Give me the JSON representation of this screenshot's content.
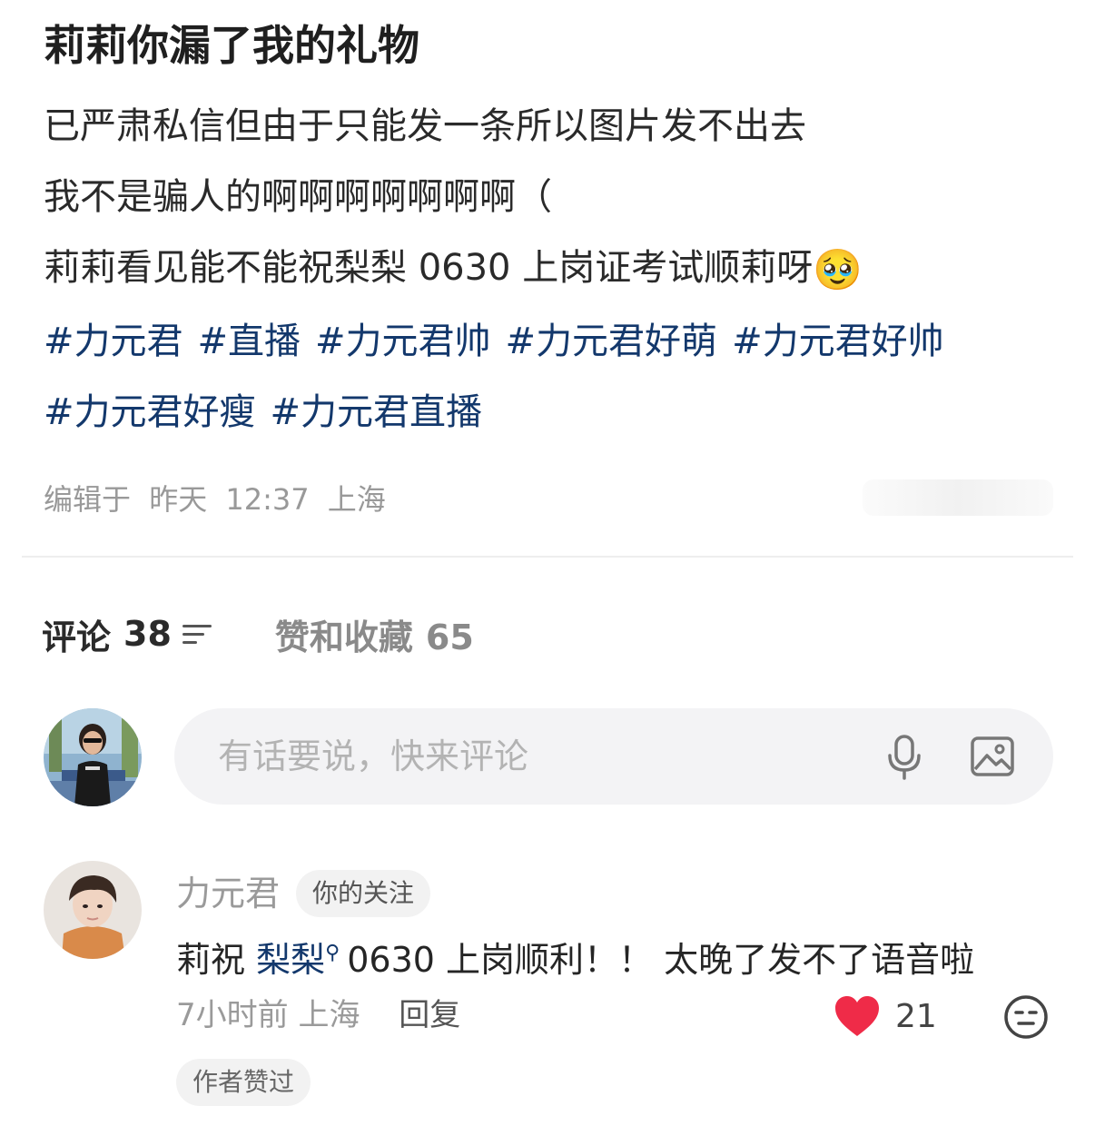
{
  "post": {
    "title": "莉莉你漏了我的礼物",
    "lines": [
      "已严肃私信但由于只能发一条所以图片发不出去",
      "我不是骗人的啊啊啊啊啊啊啊（",
      "莉莉看见能不能祝梨梨 0630 上岗证考试顺莉呀"
    ],
    "emoji": "🥹",
    "hashtags": [
      "#力元君",
      "#直播",
      "#力元君帅",
      "#力元君好萌",
      "#力元君好帅",
      "#力元君好瘦",
      "#力元君直播"
    ]
  },
  "meta": {
    "edited": "编辑于",
    "day": "昨天",
    "time": "12:37",
    "location": "上海"
  },
  "tabs": {
    "comments_label": "评论",
    "comments_count": "38",
    "likes_label": "赞和收藏",
    "likes_count": "65"
  },
  "composer": {
    "placeholder": "有话要说，快来评论",
    "mic_icon": "microphone-icon",
    "image_icon": "image-icon"
  },
  "comment": {
    "author": "力元君",
    "badge": "你的关注",
    "text_before": "莉祝",
    "mention": "梨梨",
    "text_after": "0630 上岗顺利！！ 太晚了发不了语音啦",
    "time": "7小时前",
    "location": "上海",
    "reply": "回复",
    "likes": "21",
    "author_liked": "作者赞过",
    "heart_color": "#ef2b48"
  },
  "colors": {
    "hashtag": "#13386c",
    "muted": "#999999",
    "input_bg": "#f3f3f5"
  }
}
